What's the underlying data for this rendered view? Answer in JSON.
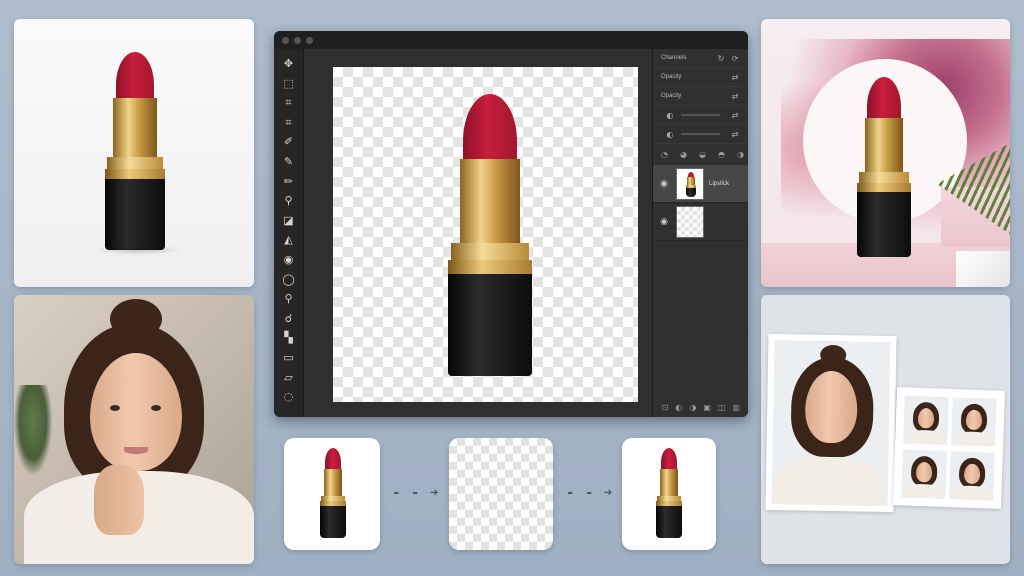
{
  "editor": {
    "window_dots": [
      "close",
      "minimize",
      "zoom"
    ],
    "tools": [
      {
        "name": "move-icon",
        "glyph": "✥"
      },
      {
        "name": "marquee-icon",
        "glyph": "⬚"
      },
      {
        "name": "crop-icon",
        "glyph": "⌗"
      },
      {
        "name": "crop-alt-icon",
        "glyph": "⌗"
      },
      {
        "name": "eyedropper-icon",
        "glyph": "✐"
      },
      {
        "name": "brush-icon",
        "glyph": "✎"
      },
      {
        "name": "pencil-icon",
        "glyph": "✏"
      },
      {
        "name": "stamp-icon",
        "glyph": "⚲"
      },
      {
        "name": "eraser-icon",
        "glyph": "◪"
      },
      {
        "name": "gradient-icon",
        "glyph": "◭"
      },
      {
        "name": "blur-icon",
        "glyph": "◉"
      },
      {
        "name": "dodge-icon",
        "glyph": "◯"
      },
      {
        "name": "zoom-icon",
        "glyph": "⚲"
      },
      {
        "name": "hand-icon",
        "glyph": "☌"
      },
      {
        "name": "color-swatch-icon",
        "glyph": "▚"
      },
      {
        "name": "screen-mode-icon",
        "glyph": "▭"
      },
      {
        "name": "shape-icon",
        "glyph": "▱"
      },
      {
        "name": "lasso-icon",
        "glyph": "◌"
      }
    ],
    "panel": {
      "rows": [
        {
          "label": "Channels"
        },
        {
          "label": "Opacity"
        },
        {
          "label": "Opacity"
        }
      ],
      "layers": [
        {
          "name": "Lipstick",
          "active": true
        },
        {
          "name": "",
          "active": false
        }
      ]
    }
  },
  "thumbnails": {
    "arrows": [
      "- - ➜",
      "- - ➜"
    ]
  }
}
